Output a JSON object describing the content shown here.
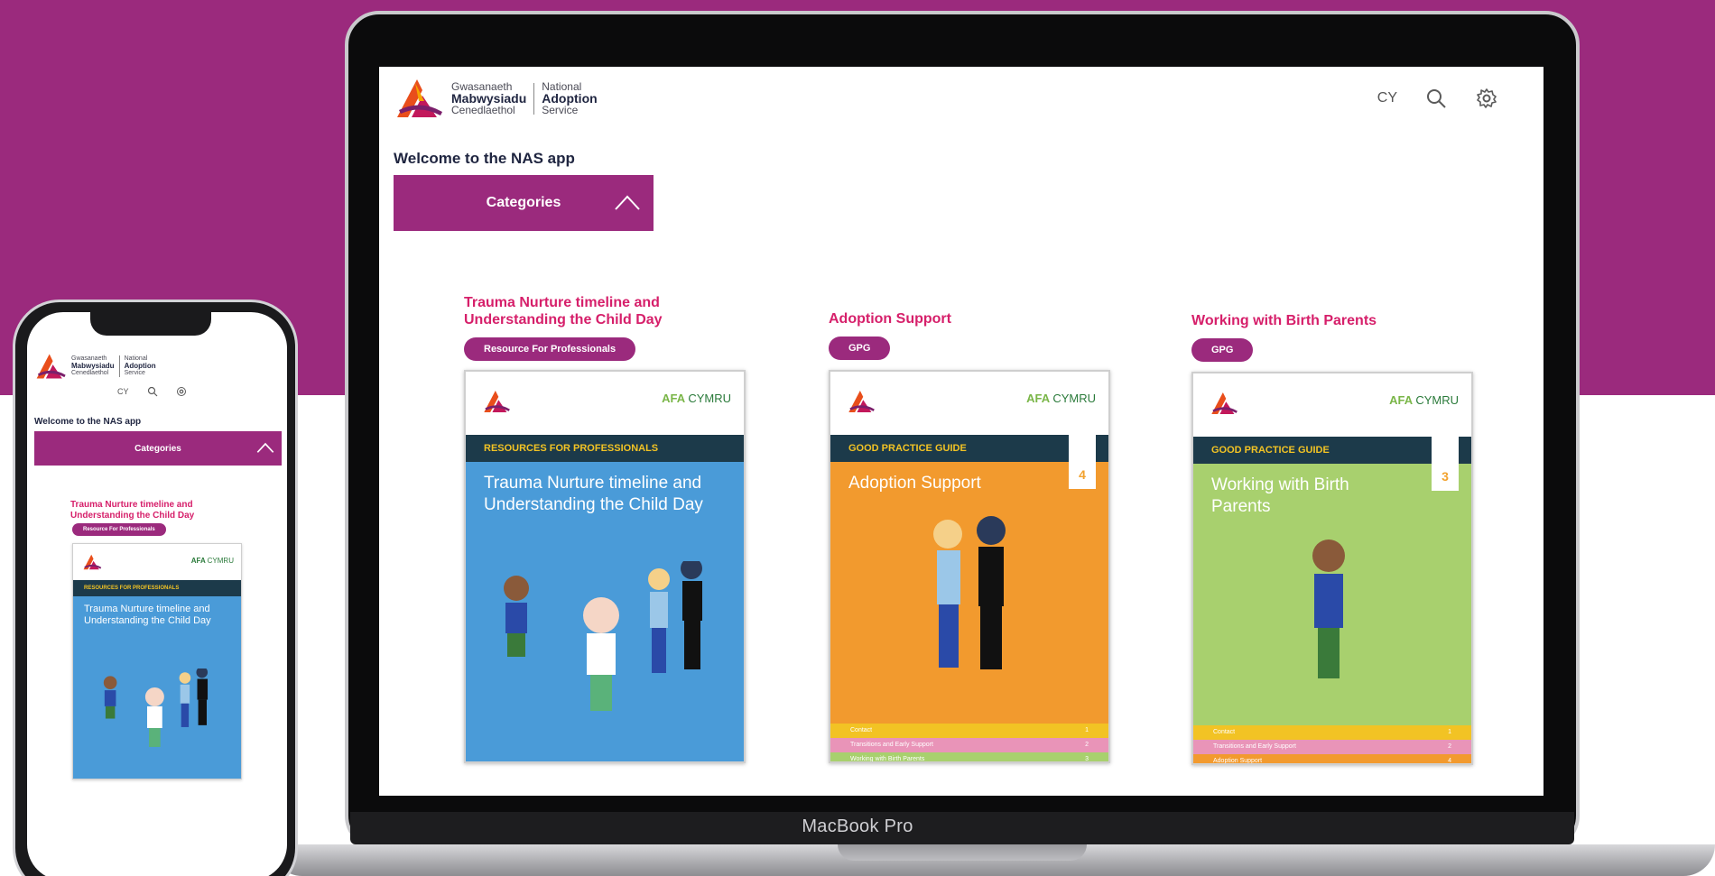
{
  "app": {
    "logo": {
      "welsh_line1": "Gwasanaeth",
      "welsh_line2": "Mabwysiadu",
      "welsh_line3": "Cenedlaethol",
      "english_line1": "National",
      "english_line2": "Adoption",
      "english_line3": "Service"
    },
    "language_toggle": "CY",
    "welcome": "Welcome to the NAS app",
    "categories_label": "Categories",
    "cards": [
      {
        "title": "Trauma Nurture timeline and Understanding the Child Day",
        "tag": "Resource For Professionals",
        "band": "RESOURCES FOR PROFESSIONALS",
        "cover_title": "Trauma Nurture timeline and Understanding the Child Day"
      },
      {
        "title": "Adoption Support",
        "tag": "GPG",
        "band": "GOOD PRACTICE GUIDE",
        "cover_title": "Adoption Support",
        "number": "4",
        "toc": [
          {
            "label": "Contact",
            "num": "1"
          },
          {
            "label": "Transitions and Early Support",
            "num": "2"
          },
          {
            "label": "Working with Birth Parents",
            "num": "3"
          }
        ]
      },
      {
        "title": "Working with Birth Parents",
        "tag": "GPG",
        "band": "GOOD PRACTICE GUIDE",
        "cover_title": "Working with Birth Parents",
        "number": "3",
        "toc": [
          {
            "label": "Contact",
            "num": "1"
          },
          {
            "label": "Transitions and Early Support",
            "num": "2"
          },
          {
            "label": "Adoption Support",
            "num": "4"
          }
        ]
      }
    ],
    "afa": {
      "part1": "AFA",
      "part2": "CYMRU"
    }
  },
  "device": {
    "laptop_label": "MacBook Pro"
  },
  "colors": {
    "brand": "#9b2a7d",
    "accent_title": "#d61f6a",
    "band": "#1c3a4a",
    "cover_blue": "#4a9bd8",
    "cover_orange": "#f29a2e",
    "cover_green": "#a8d06e"
  },
  "icons": [
    "search-icon",
    "settings-icon",
    "chevron-up-icon",
    "logo-mark-icon"
  ]
}
